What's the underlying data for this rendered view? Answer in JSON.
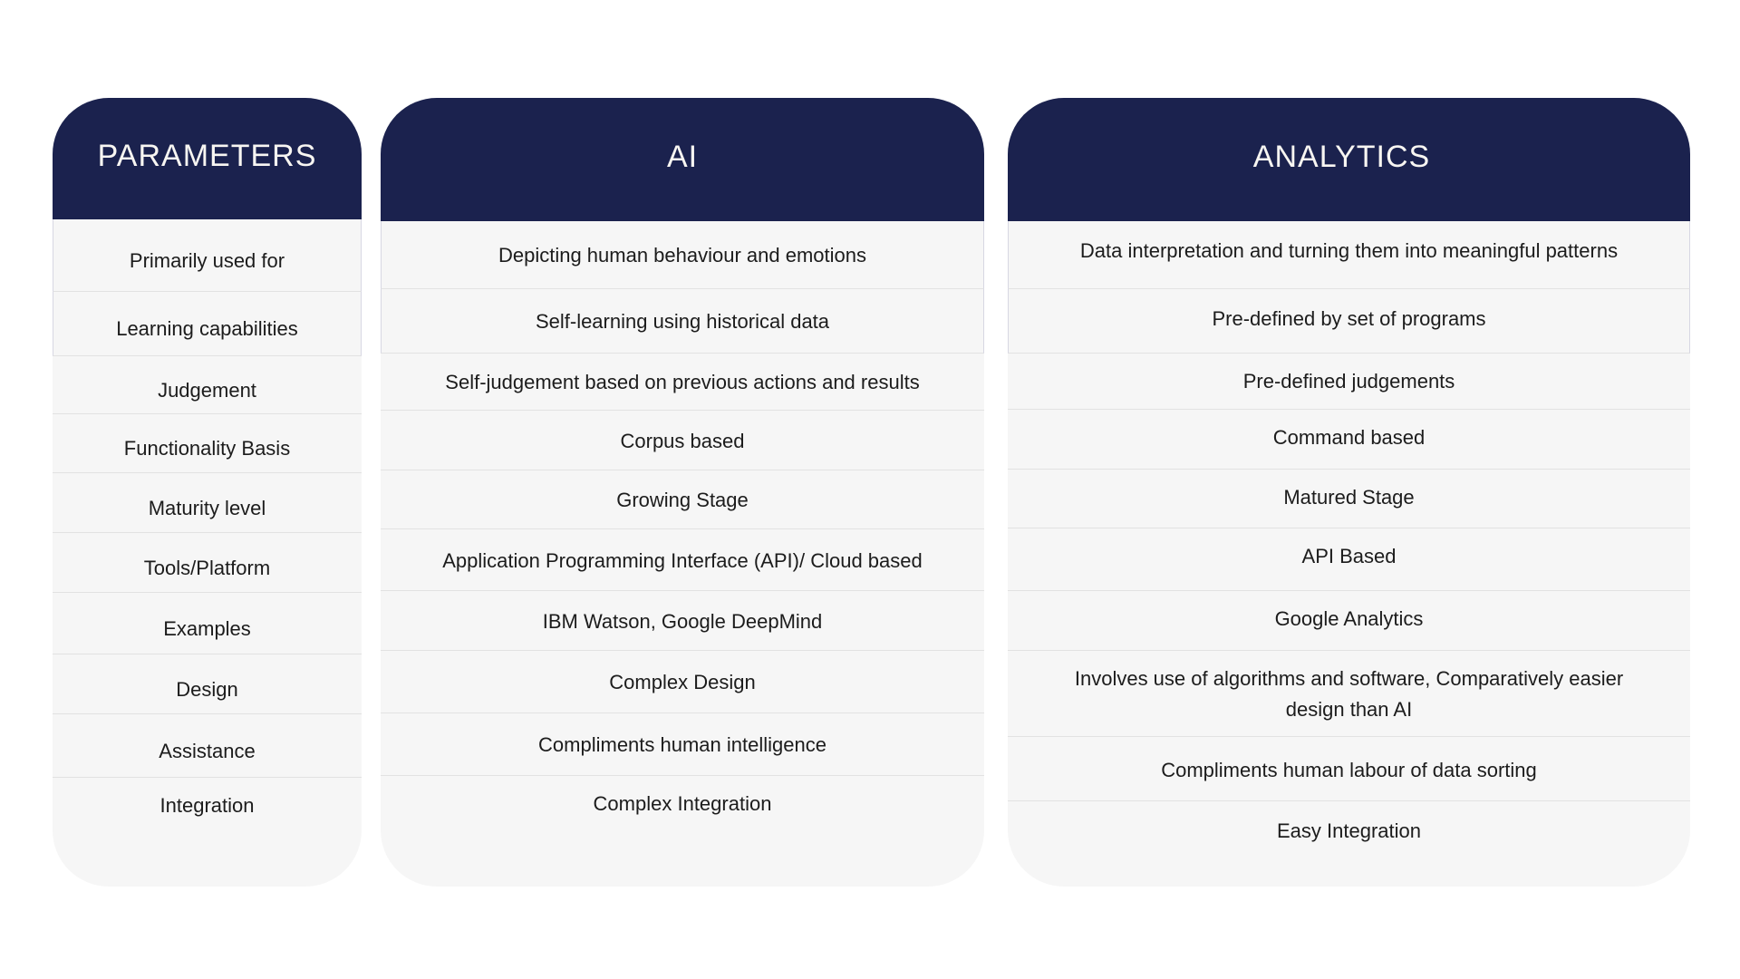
{
  "colors": {
    "header_bg": "#1b224e",
    "header_text": "#f8f6f2",
    "body_bg": "#f6f6f6",
    "body_text": "#1c1c1c",
    "divider": "#e2e2e2"
  },
  "columns": {
    "parameters": {
      "title": "PARAMETERS",
      "rows": [
        "Primarily used for",
        "Learning capabilities",
        "Judgement",
        "Functionality Basis",
        "Maturity level",
        "Tools/Platform",
        "Examples",
        "Design",
        "Assistance",
        "Integration"
      ]
    },
    "ai": {
      "title": "AI",
      "rows": [
        "Depicting human behaviour and emotions",
        "Self-learning using historical data",
        "Self-judgement based on previous actions and results",
        "Corpus based",
        "Growing Stage",
        "Application Programming Interface (API)/ Cloud based",
        "IBM Watson, Google DeepMind",
        "Complex Design",
        "Compliments human intelligence",
        "Complex Integration"
      ]
    },
    "analytics": {
      "title": "ANALYTICS",
      "rows": [
        "Data interpretation and turning them into meaningful patterns",
        "Pre-defined by set of programs",
        "Pre-defined judgements",
        "Command based",
        "Matured Stage",
        "API Based",
        "Google Analytics",
        "Involves use of algorithms and software, Comparatively easier design than AI",
        "Compliments human labour of data sorting",
        "Easy Integration"
      ]
    }
  }
}
